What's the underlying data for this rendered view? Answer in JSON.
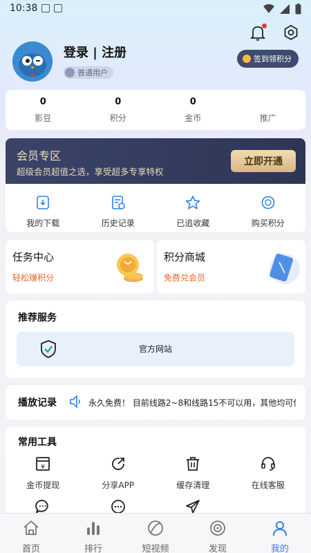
{
  "status_bar": {
    "time": "10:38"
  },
  "profile": {
    "login_label": "登录 | 注册",
    "user_level": "普通用户",
    "checkin_label": "签到领积分"
  },
  "stats": [
    {
      "value": "0",
      "label": "影豆"
    },
    {
      "value": "0",
      "label": "积分"
    },
    {
      "value": "0",
      "label": "金币"
    },
    {
      "value": "",
      "label": "推广"
    }
  ],
  "vip": {
    "title": "会员专区",
    "description": "超级会员超值之选，享受超多专享特权",
    "button": "立即开通"
  },
  "quick_actions": [
    {
      "label": "我的下载",
      "icon": "download-icon"
    },
    {
      "label": "历史记录",
      "icon": "history-icon"
    },
    {
      "label": "已追收藏",
      "icon": "star-icon"
    },
    {
      "label": "购买积分",
      "icon": "coin-icon"
    }
  ],
  "task_center": {
    "title": "任务中心",
    "subtitle": "轻松赚积分"
  },
  "points_mall": {
    "title": "积分商城",
    "subtitle": "免费兑会员"
  },
  "recommend": {
    "title": "推荐服务",
    "official_site": "官方网站"
  },
  "history": {
    "title": "播放记录",
    "marquee": "永久免费！ 目前线路2~8和线路15不可以用，其他均可使"
  },
  "tools": {
    "title": "常用工具",
    "items": [
      {
        "label": "金币提现",
        "icon": "withdraw-icon"
      },
      {
        "label": "分享APP",
        "icon": "share-icon"
      },
      {
        "label": "缓存清理",
        "icon": "trash-icon"
      },
      {
        "label": "在线客服",
        "icon": "headset-icon"
      },
      {
        "label": "",
        "icon": "chat-icon"
      },
      {
        "label": "",
        "icon": "more-icon"
      },
      {
        "label": "",
        "icon": "send-icon"
      },
      {
        "label": "",
        "icon": ""
      }
    ]
  },
  "tabbar": [
    {
      "label": "首页",
      "icon": "home-icon"
    },
    {
      "label": "排行",
      "icon": "ranking-icon"
    },
    {
      "label": "短视频",
      "icon": "short-video-icon"
    },
    {
      "label": "发现",
      "icon": "discover-icon"
    },
    {
      "label": "我的",
      "icon": "profile-icon",
      "active": true
    }
  ],
  "colors": {
    "accent": "#2f80ed",
    "vip_bg": "#3a4468",
    "vip_gold": "#f3dcb3",
    "highlight_orange": "#e56a2b"
  }
}
